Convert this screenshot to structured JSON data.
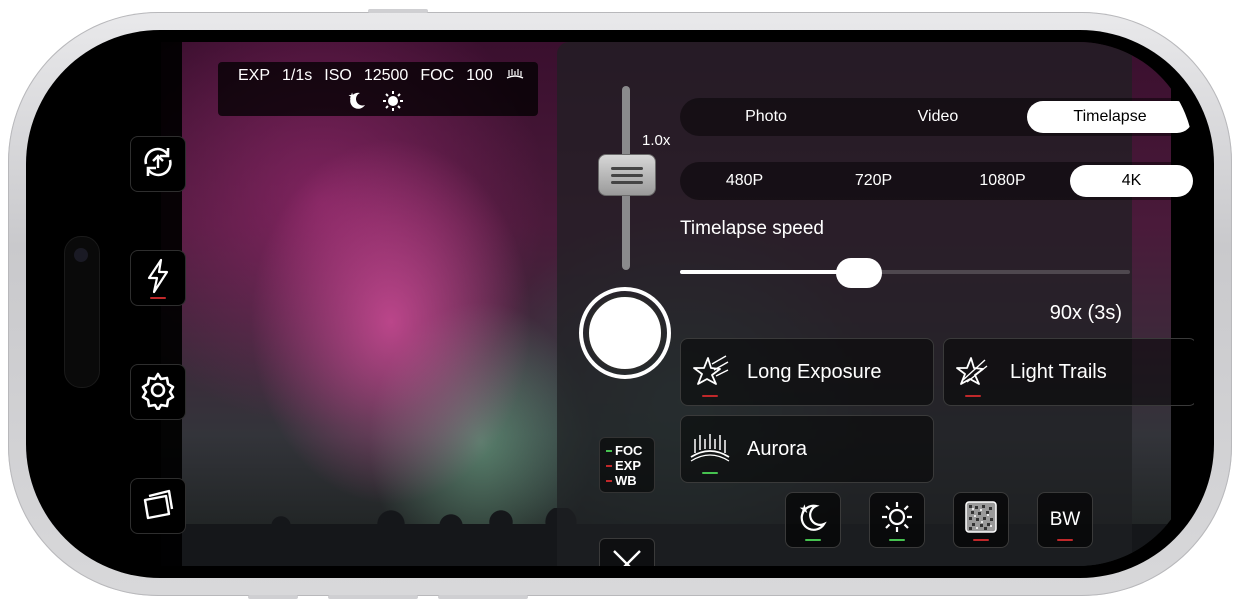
{
  "info_bar": {
    "exp_label": "EXP",
    "exp_value": "1/1s",
    "iso_label": "ISO",
    "iso_value": "12500",
    "foc_label": "FOC",
    "foc_value": "100",
    "aurora_icon": "aurora-icon",
    "night_icon": "moon-star-icon",
    "sun_icon": "sun-icon"
  },
  "left_toolbar": [
    {
      "icon": "rotate-camera-icon"
    },
    {
      "icon": "flash-icon",
      "indicator": "red"
    },
    {
      "icon": "gear-icon"
    },
    {
      "icon": "gallery-icon"
    }
  ],
  "zoom": {
    "label": "1.0x"
  },
  "mode_indicators": {
    "foc": "FOC",
    "exp": "EXP",
    "wb": "WB"
  },
  "capture_modes": {
    "options": [
      "Photo",
      "Video",
      "Timelapse"
    ],
    "selected": "Timelapse"
  },
  "resolutions": {
    "options": [
      "480P",
      "720P",
      "1080P",
      "4K"
    ],
    "selected": "4K"
  },
  "timelapse": {
    "label": "Timelapse speed",
    "value": "90x (3s)",
    "slider_fraction": 0.36
  },
  "effects": [
    {
      "name": "Long Exposure",
      "icon": "long-exposure-icon",
      "indicator": "red"
    },
    {
      "name": "Light Trails",
      "icon": "light-trails-icon",
      "indicator": "red"
    },
    {
      "name": "Aurora",
      "icon": "aurora-icon",
      "indicator": "green"
    }
  ],
  "filters": [
    {
      "icon": "moon-star-icon",
      "indicator": "green"
    },
    {
      "icon": "sun-icon",
      "indicator": "green"
    },
    {
      "icon": "noise-icon",
      "indicator": "red"
    },
    {
      "label": "BW",
      "indicator": "red"
    }
  ],
  "colors": {
    "indicator_red": "#c0282a",
    "indicator_green": "#46c250",
    "active_segment": "#ffffff"
  }
}
